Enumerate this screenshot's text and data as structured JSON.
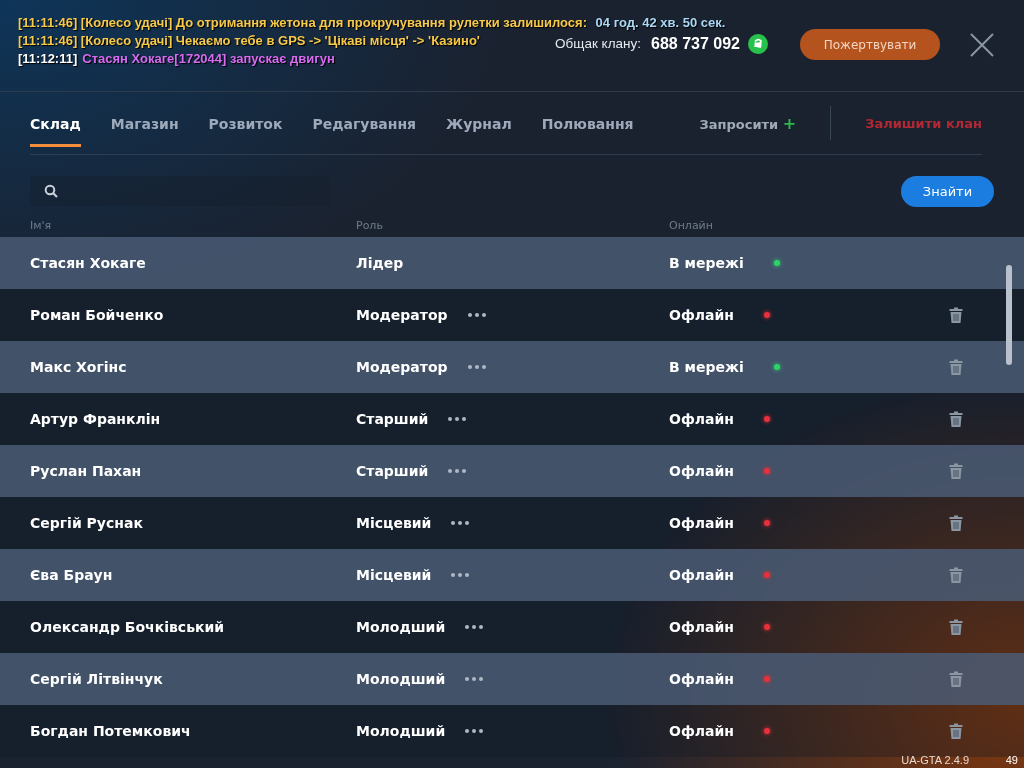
{
  "chat": [
    {
      "segments": [
        {
          "text": "[11:11:46] [Колесо удачі] До отримання жетона для прокручування рулетки залишилося: ",
          "color": "#f7c948"
        },
        {
          "text": "04 год. 42 хв. 50 сек.",
          "color": "#a9d8f5"
        }
      ]
    },
    {
      "segments": [
        {
          "text": "[11:11:46] [Колесо удачі] Чекаємо тебе в GPS -> 'Цікаві місця' -> 'Казино'",
          "color": "#f7c948"
        }
      ]
    },
    {
      "segments": [
        {
          "text": "[11:12:11]",
          "color": "#ffffff"
        },
        {
          "text": "Стасян Хокаге[172044] запускає двигун",
          "color": "#d76af0"
        }
      ]
    }
  ],
  "balance": {
    "label": "Общак клану:",
    "value": "688 737 092"
  },
  "donate_button": "Пожертвувати",
  "tabs": [
    {
      "label": "Склад",
      "selected": true
    },
    {
      "label": "Магазин",
      "selected": false
    },
    {
      "label": "Розвиток",
      "selected": false
    },
    {
      "label": "Редагування",
      "selected": false
    },
    {
      "label": "Журнал",
      "selected": false
    },
    {
      "label": "Полювання",
      "selected": false
    }
  ],
  "invite": {
    "label": "Запросити",
    "icon": "+"
  },
  "leave": "Залишити клан",
  "search_button": "Знайти",
  "columns": [
    "Ім'я",
    "Роль",
    "Онлайн"
  ],
  "members": [
    {
      "name": "Стасян Хокаге",
      "role": "Лідер",
      "status": "В мережі",
      "online": true,
      "manageable": false
    },
    {
      "name": "Роман Бойченко",
      "role": "Модератор",
      "status": "Офлайн",
      "online": false,
      "manageable": true
    },
    {
      "name": "Макс Хогінс",
      "role": "Модератор",
      "status": "В мережі",
      "online": true,
      "manageable": true
    },
    {
      "name": "Артур Франклін",
      "role": "Старший",
      "status": "Офлайн",
      "online": false,
      "manageable": true
    },
    {
      "name": "Руслан Пахан",
      "role": "Старший",
      "status": "Офлайн",
      "online": false,
      "manageable": true
    },
    {
      "name": "Сергій Руснак",
      "role": "Місцевий",
      "status": "Офлайн",
      "online": false,
      "manageable": true
    },
    {
      "name": "Єва Браун",
      "role": "Місцевий",
      "status": "Офлайн",
      "online": false,
      "manageable": true
    },
    {
      "name": "Олександр Бочківський",
      "role": "Молодший",
      "status": "Офлайн",
      "online": false,
      "manageable": true
    },
    {
      "name": "Сергій Літвінчук",
      "role": "Молодший",
      "status": "Офлайн",
      "online": false,
      "manageable": true
    },
    {
      "name": "Богдан Потемкович",
      "role": "Молодший",
      "status": "Офлайн",
      "online": false,
      "manageable": true
    }
  ],
  "version": "UA-GTA 2.4.9",
  "fps": "49"
}
